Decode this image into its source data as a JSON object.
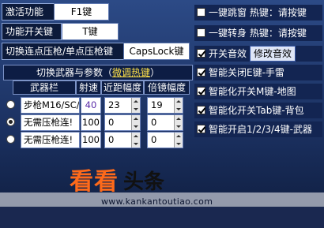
{
  "rows": {
    "activate": {
      "label": "激活功能",
      "value": "F1键"
    },
    "toggle": {
      "label": "功能开关键",
      "value": "T键"
    },
    "switchmode": {
      "label": "切换连点压枪/单点压枪键",
      "value": "CapsLock键"
    }
  },
  "header": {
    "text": "切换武器与参数（",
    "hot": "微调热键",
    "close": "）"
  },
  "columns": [
    "武器栏",
    "射速",
    "近距幅度",
    "倍镜幅度"
  ],
  "weapons": [
    {
      "name": "步枪M16/SC/",
      "rate": "40",
      "near": "23",
      "scope": "19",
      "selected": false
    },
    {
      "name": "无需压枪连!",
      "rate": "100",
      "near": "0",
      "scope": "0",
      "selected": true
    },
    {
      "name": "无需压枪连!",
      "rate": "100",
      "near": "0",
      "scope": "0",
      "selected": false
    }
  ],
  "options": [
    {
      "label": "一键跳窗  热键：请按键",
      "checked": false
    },
    {
      "label": "一键转身  热键：请按键",
      "checked": false
    },
    {
      "label": "开关音效",
      "checked": true,
      "button": "修改音效"
    },
    {
      "label": "智能关闭E键-手雷",
      "checked": true
    },
    {
      "label": "智能化开关M键-地图",
      "checked": true
    },
    {
      "label": "智能化开关Tab键-背包",
      "checked": true
    },
    {
      "label": "智能开启1/2/3/4键-武器",
      "checked": true
    }
  ],
  "watermark": {
    "brand": "看看",
    "suffix": "头条",
    "url": "www.kankantoutiao.com"
  }
}
